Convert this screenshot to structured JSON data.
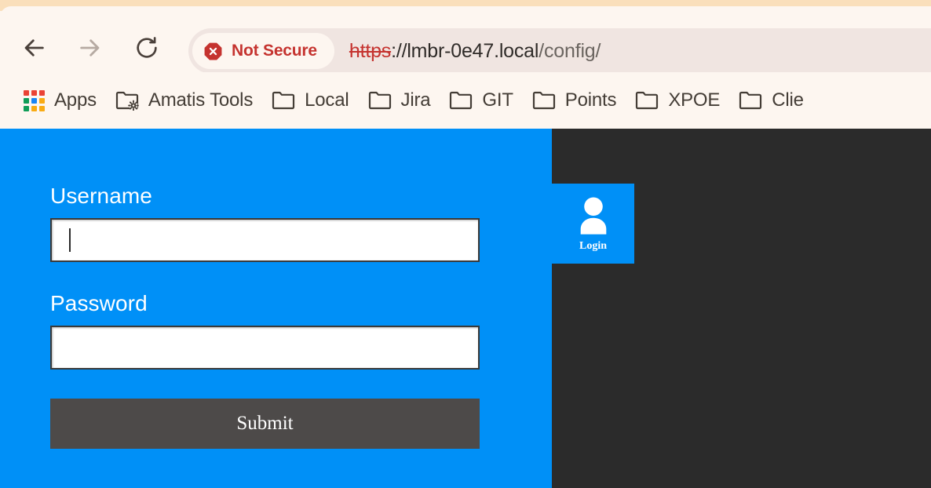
{
  "browser": {
    "nav": {
      "back_label": "Back",
      "forward_label": "Forward",
      "reload_label": "Reload"
    },
    "omnibox": {
      "security_badge": "Not Secure",
      "security_icon": "octagon-x-icon",
      "url_scheme": "https",
      "url_separator": "://",
      "url_host": "lmbr-0e47.local",
      "url_path": "/config/",
      "full_url": "https://lmbr-0e47.local/config/"
    },
    "bookmarks": [
      {
        "label": "Apps",
        "icon": "apps-grid-icon"
      },
      {
        "label": "Amatis Tools",
        "icon": "folder-gear-icon"
      },
      {
        "label": "Local",
        "icon": "folder-icon"
      },
      {
        "label": "Jira",
        "icon": "folder-icon"
      },
      {
        "label": "GIT",
        "icon": "folder-icon"
      },
      {
        "label": "Points",
        "icon": "folder-icon"
      },
      {
        "label": "XPOE",
        "icon": "folder-icon"
      },
      {
        "label": "Clie",
        "icon": "folder-icon"
      }
    ]
  },
  "page": {
    "form": {
      "username_label": "Username",
      "username_value": "",
      "password_label": "Password",
      "password_value": "",
      "submit_label": "Submit"
    },
    "login_tile": {
      "label": "Login",
      "icon": "person-icon"
    }
  },
  "colors": {
    "panel_blue": "#0090f7",
    "page_dark": "#2b2b2b",
    "submit_gray": "#4d4a49",
    "chrome_bg": "#fdf6f0",
    "omnibox_bg": "#f0e5e1",
    "tabstrip_bg": "#fadfbb",
    "danger_red": "#c5332f"
  }
}
